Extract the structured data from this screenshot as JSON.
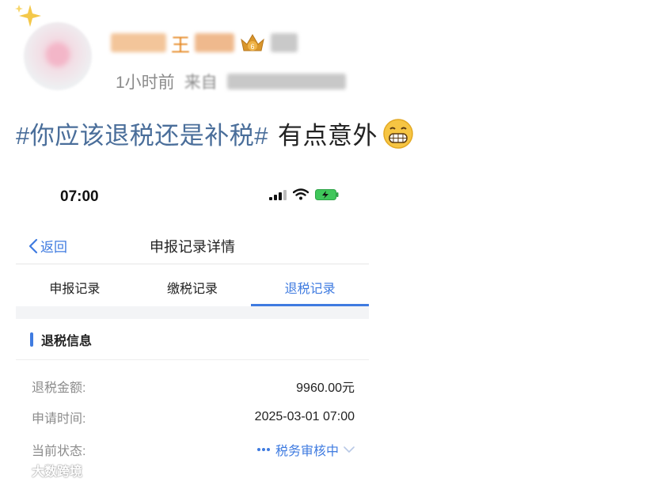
{
  "post": {
    "username_visible_char": "王",
    "relative_time": "1小时前",
    "source_prefix": "来自",
    "hashtag": "#你应该退税还是补税#",
    "comment": "有点意外"
  },
  "phone": {
    "status_time": "07:00",
    "back_label": "返回",
    "page_title": "申报记录详情",
    "tabs": [
      {
        "label": "申报记录",
        "active": false
      },
      {
        "label": "缴税记录",
        "active": false
      },
      {
        "label": "退税记录",
        "active": true
      }
    ],
    "section_title": "退税信息",
    "rows": [
      {
        "label": "退税金额:",
        "value": "9960.00元"
      },
      {
        "label": "申请时间:",
        "value": "2025-03-01 07:00"
      },
      {
        "label": "当前状态:",
        "value": "税务审核中"
      }
    ]
  },
  "watermark": "大数跨境",
  "colors": {
    "accent_blue": "#3f7be0",
    "hashtag_blue": "#4a6e9a",
    "muted_gray": "#8c8c8c",
    "battery_green": "#3fc75a"
  }
}
